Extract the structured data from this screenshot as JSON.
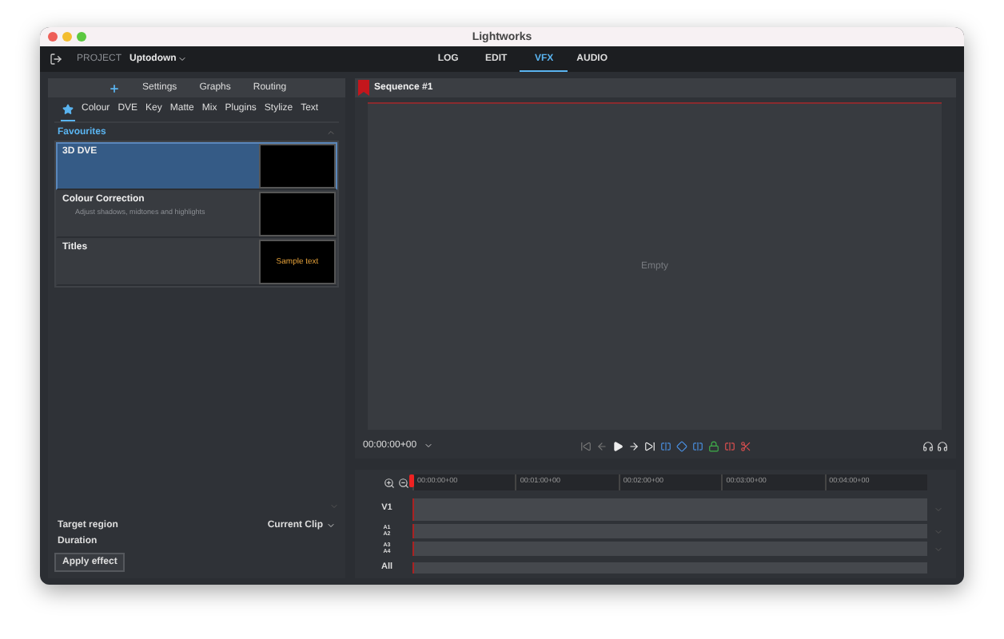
{
  "window": {
    "title": "Lightworks"
  },
  "project_bar": {
    "label": "PROJECT",
    "project": "Uptodown"
  },
  "nav_tabs": [
    {
      "label": "LOG",
      "selected": false
    },
    {
      "label": "EDIT",
      "selected": false
    },
    {
      "label": "VFX",
      "selected": true
    },
    {
      "label": "AUDIO",
      "selected": false
    }
  ],
  "effects_panel": {
    "panel_tabs": [
      {
        "kind": "add"
      },
      {
        "kind": "text",
        "label": "Settings"
      },
      {
        "kind": "text",
        "label": "Graphs"
      },
      {
        "kind": "text",
        "label": "Routing"
      }
    ],
    "categories": [
      {
        "kind": "star",
        "selected": true
      },
      {
        "kind": "text",
        "label": "Colour",
        "selected": false
      },
      {
        "kind": "text",
        "label": "DVE",
        "selected": false
      },
      {
        "kind": "text",
        "label": "Key",
        "selected": false
      },
      {
        "kind": "text",
        "label": "Matte",
        "selected": false
      },
      {
        "kind": "text",
        "label": "Mix",
        "selected": false
      },
      {
        "kind": "text",
        "label": "Plugins",
        "selected": false
      },
      {
        "kind": "text",
        "label": "Stylize",
        "selected": false
      },
      {
        "kind": "text",
        "label": "Text",
        "selected": false
      }
    ],
    "group": {
      "title": "Favourites",
      "expanded": true
    },
    "effects": [
      {
        "name": "3D DVE",
        "selected": true
      },
      {
        "name": "Colour Correction",
        "description": "Adjust shadows, midtones and highlights",
        "selected": false
      },
      {
        "name": "Titles",
        "selected": false,
        "preview_text": "Sample text"
      }
    ],
    "target_region": {
      "label": "Target region",
      "value": "Current Clip"
    },
    "duration": {
      "label": "Duration"
    },
    "apply_button": "Apply effect"
  },
  "viewer": {
    "title": "Sequence #1",
    "placeholder": "Empty",
    "timecode": "00:00:00+00"
  },
  "timeline": {
    "ruler": [
      "00:00:00+00",
      "00:01:00+00",
      "00:02:00+00",
      "00:03:00+00",
      "00:04:00+00"
    ],
    "tracks": [
      {
        "kind": "video",
        "labels": [
          "V1"
        ]
      },
      {
        "kind": "audio",
        "labels": [
          "A1",
          "A2"
        ]
      },
      {
        "kind": "audio",
        "labels": [
          "A3",
          "A4"
        ]
      },
      {
        "kind": "all",
        "labels": [
          "All"
        ]
      }
    ]
  }
}
